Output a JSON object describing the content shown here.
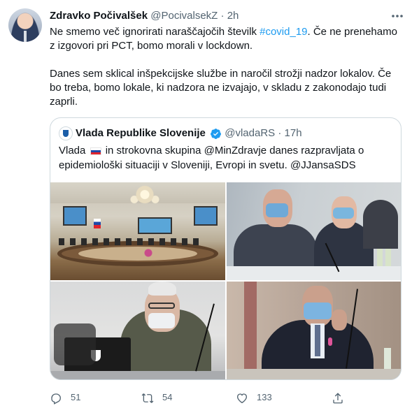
{
  "tweet": {
    "author_name": "Zdravko Počivalšek",
    "handle": "@PocivalsekZ",
    "separator": "·",
    "time": "2h",
    "text_line1_a": "Ne smemo več ignorirati naraščajočih številk ",
    "hashtag": "#covid_19",
    "text_line1_b": ". Če ne prenehamo z izgovori pri PCT, bomo morali v lockdown.",
    "text_para2": "Danes sem sklical inšpekcijske službe in naročil strožji nadzor lokalov. Če bo treba, bomo lokale, ki nadzora ne izvajajo, v skladu z zakonodajo tudi zaprli."
  },
  "quote": {
    "author_name": "Vlada Republike Slovenije",
    "handle": "@vladaRS",
    "separator": "·",
    "time": "17h",
    "text_a": "Vlada",
    "text_b": " in strokovna skupina @MinZdravje danes razpravljata o epidemiološki situaciji v Sloveniji, Evropi in svetu. @JJansaSDS"
  },
  "actions": {
    "replies": "51",
    "retweets": "54",
    "likes": "133"
  },
  "icons": {
    "more": "more-icon",
    "reply": "reply-icon",
    "retweet": "retweet-icon",
    "like": "heart-icon",
    "share": "share-icon",
    "verified": "verified-icon",
    "flag": "slovenia-flag-icon"
  },
  "colors": {
    "link": "#1d9bf0",
    "muted": "#536471",
    "text": "#0f1419",
    "border": "#cfd9de"
  }
}
